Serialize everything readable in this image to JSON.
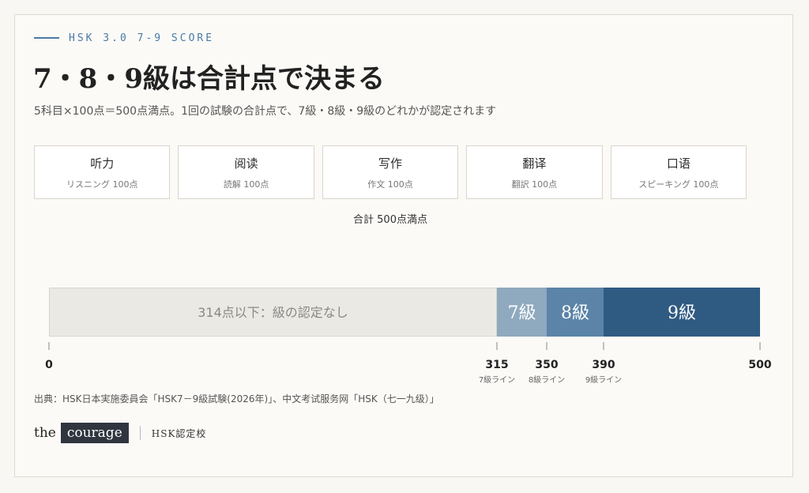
{
  "header": {
    "eyebrow": "HSK 3.0 7-9 SCORE",
    "title": "7・8・9級は合計点で決まる",
    "subtitle": "5科目×100点＝500点満点。1回の試験の合計点で、7級・8級・9級のどれかが認定されます"
  },
  "subjects": [
    {
      "name": "听力",
      "sub": "リスニング 100点"
    },
    {
      "name": "阅读",
      "sub": "読解 100点"
    },
    {
      "name": "写作",
      "sub": "作文 100点"
    },
    {
      "name": "翻译",
      "sub": "翻訳 100点"
    },
    {
      "name": "口语",
      "sub": "スピーキング 100点"
    }
  ],
  "total_label": "合計 500点満点",
  "colors": {
    "none": "#ebe9e4",
    "lv7": "#8fa9bf",
    "lv8": "#5b84a8",
    "lv9": "#2f5a82"
  },
  "chart_data": {
    "type": "bar",
    "range": [
      0,
      500
    ],
    "segments": [
      {
        "label": "314点以下：級の認定なし",
        "from": 0,
        "to": 315,
        "color": "#ebe9e4",
        "text_color": "#888888"
      },
      {
        "label": "7級",
        "from": 315,
        "to": 350,
        "color": "#8fa9bf",
        "text_color": "#ffffff"
      },
      {
        "label": "8級",
        "from": 350,
        "to": 390,
        "color": "#5b84a8",
        "text_color": "#ffffff"
      },
      {
        "label": "9級",
        "from": 390,
        "to": 500,
        "color": "#2f5a82",
        "text_color": "#ffffff"
      }
    ],
    "ticks": [
      {
        "value": 0,
        "label": "0",
        "sublabel": ""
      },
      {
        "value": 315,
        "label": "315",
        "sublabel": "7級ライン"
      },
      {
        "value": 350,
        "label": "350",
        "sublabel": "8級ライン"
      },
      {
        "value": 390,
        "label": "390",
        "sublabel": "9級ライン"
      },
      {
        "value": 500,
        "label": "500",
        "sublabel": ""
      }
    ]
  },
  "source": "出典：HSK日本実施委員会「HSK7－9級試験(2026年)」、中文考试服务网「HSK（七一九级）」",
  "brand": {
    "the": "the",
    "courage": "courage",
    "school": "HSK認定校"
  }
}
